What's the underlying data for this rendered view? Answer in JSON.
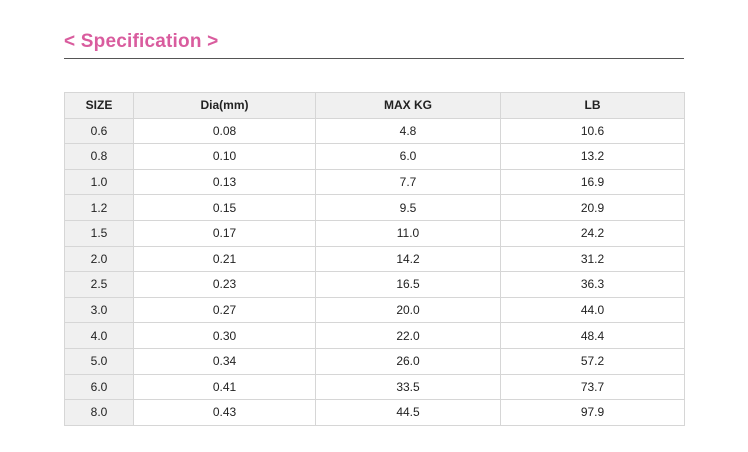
{
  "heading": "< Specification >",
  "colors": {
    "heading": "#d95c9e",
    "header_bg": "#f0f0f0",
    "border": "#d6d6d6"
  },
  "table": {
    "headers": [
      "SIZE",
      "Dia(mm)",
      "MAX KG",
      "LB"
    ],
    "rows": [
      [
        "0.6",
        "0.08",
        "4.8",
        "10.6"
      ],
      [
        "0.8",
        "0.10",
        "6.0",
        "13.2"
      ],
      [
        "1.0",
        "0.13",
        "7.7",
        "16.9"
      ],
      [
        "1.2",
        "0.15",
        "9.5",
        "20.9"
      ],
      [
        "1.5",
        "0.17",
        "11.0",
        "24.2"
      ],
      [
        "2.0",
        "0.21",
        "14.2",
        "31.2"
      ],
      [
        "2.5",
        "0.23",
        "16.5",
        "36.3"
      ],
      [
        "3.0",
        "0.27",
        "20.0",
        "44.0"
      ],
      [
        "4.0",
        "0.30",
        "22.0",
        "48.4"
      ],
      [
        "5.0",
        "0.34",
        "26.0",
        "57.2"
      ],
      [
        "6.0",
        "0.41",
        "33.5",
        "73.7"
      ],
      [
        "8.0",
        "0.43",
        "44.5",
        "97.9"
      ]
    ]
  }
}
